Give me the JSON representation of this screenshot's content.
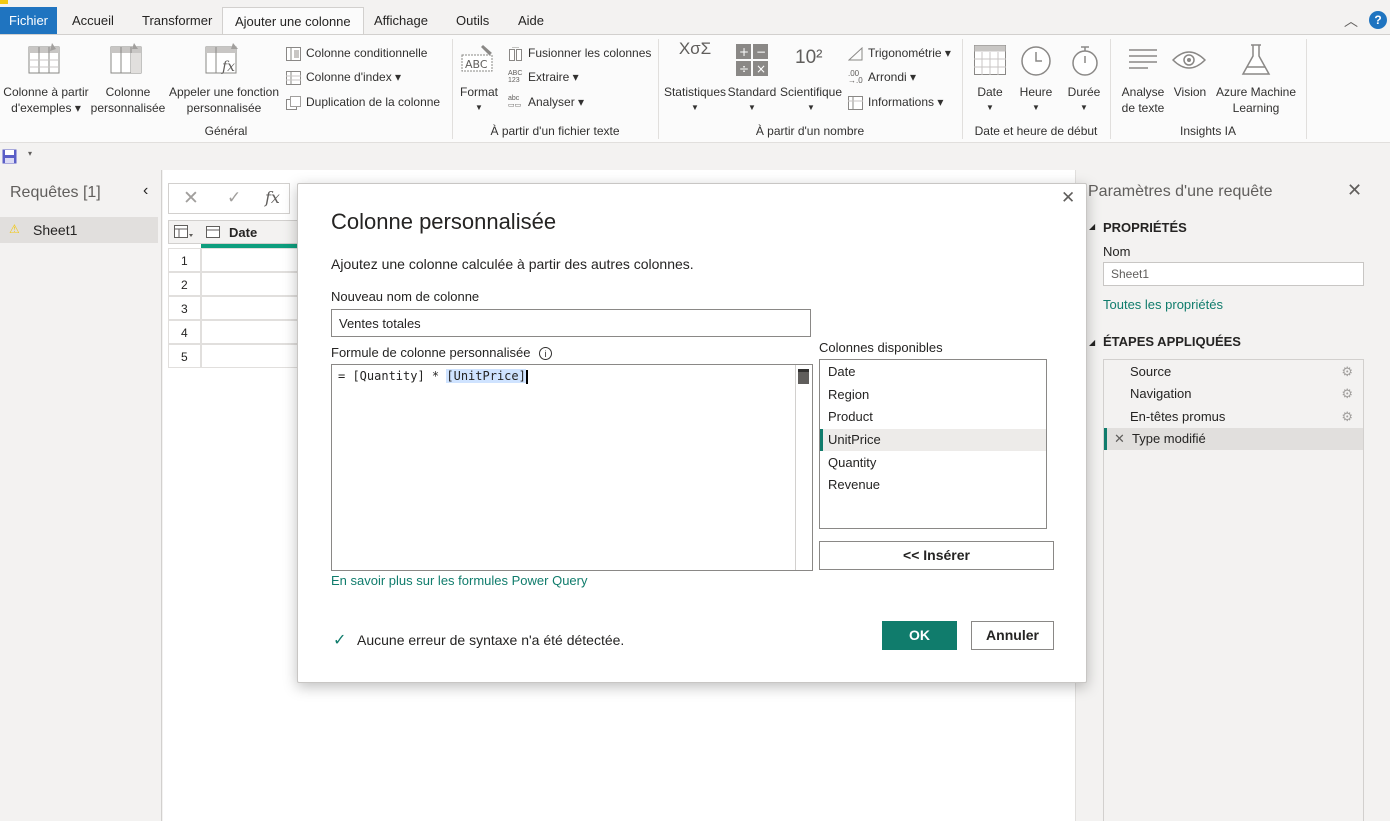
{
  "tabs": [
    {
      "label": "Fichier"
    },
    {
      "label": "Accueil"
    },
    {
      "label": "Transformer"
    },
    {
      "label": "Ajouter une colonne"
    },
    {
      "label": "Affichage"
    },
    {
      "label": "Outils"
    },
    {
      "label": "Aide"
    }
  ],
  "ribbon": {
    "general": {
      "group_label": "Général",
      "colonne_exemples": [
        "Colonne à partir",
        "d'exemples ▾"
      ],
      "colonne_perso": [
        "Colonne",
        "personnalisée"
      ],
      "appeler_fonction": [
        "Appeler une fonction",
        "personnalisée"
      ],
      "conditionnelle": "Colonne conditionnelle",
      "index": "Colonne d'index ▾",
      "duplication": "Duplication de la colonne"
    },
    "texte": {
      "group_label": "À partir d'un fichier texte",
      "format": "Format",
      "fusionner": "Fusionner les colonnes",
      "extraire": "Extraire ▾",
      "analyser": "Analyser ▾"
    },
    "nombre": {
      "group_label": "À partir d'un nombre",
      "statistiques": "Statistiques",
      "standard": "Standard",
      "scientifique": "Scientifique",
      "trigonometrie": "Trigonométrie ▾",
      "arrondi": "Arrondi ▾",
      "informations": "Informations ▾",
      "pow_text": "10²"
    },
    "date": {
      "group_label": "Date et heure de début",
      "date": "Date",
      "heure": "Heure",
      "duree": "Durée"
    },
    "ia": {
      "group_label": "Insights IA",
      "analyse_texte": [
        "Analyse",
        "de texte"
      ],
      "vision": "Vision",
      "azure_ml": [
        "Azure Machine",
        "Learning"
      ]
    }
  },
  "left_pane": {
    "title": "Requêtes [1]",
    "query": "Sheet1"
  },
  "grid": {
    "column_header": "Date",
    "rows": [
      "1",
      "2",
      "3",
      "4",
      "5"
    ]
  },
  "dialog": {
    "title": "Colonne personnalisée",
    "description": "Ajoutez une colonne calculée à partir des autres colonnes.",
    "name_label": "Nouveau nom de colonne",
    "name_value": "Ventes totales",
    "formula_label": "Formule de colonne personnalisée",
    "formula_prefix": "= [Quantity] * ",
    "formula_selected": "[UnitPrice]",
    "available_label": "Colonnes disponibles",
    "available_columns": [
      "Date",
      "Region",
      "Product",
      "UnitPrice",
      "Quantity",
      "Revenue"
    ],
    "selected_column_index": 3,
    "insert_button": "<< Insérer",
    "learn_more": "En savoir plus sur les formules Power Query",
    "status": "Aucune erreur de syntaxe n'a été détectée.",
    "ok": "OK",
    "cancel": "Annuler"
  },
  "right_pane": {
    "title": "Paramètres d'une requête",
    "properties_header": "PROPRIÉTÉS",
    "name_label": "Nom",
    "name_value": "Sheet1",
    "all_properties": "Toutes les propriétés",
    "steps_header": "ÉTAPES APPLIQUÉES",
    "steps": [
      "Source",
      "Navigation",
      "En-têtes promus",
      "Type modifié"
    ]
  },
  "colors": {
    "accent": "#107c6c",
    "file_tab": "#1f74c0",
    "link": "#107c6c",
    "warning": "#f2c811"
  }
}
